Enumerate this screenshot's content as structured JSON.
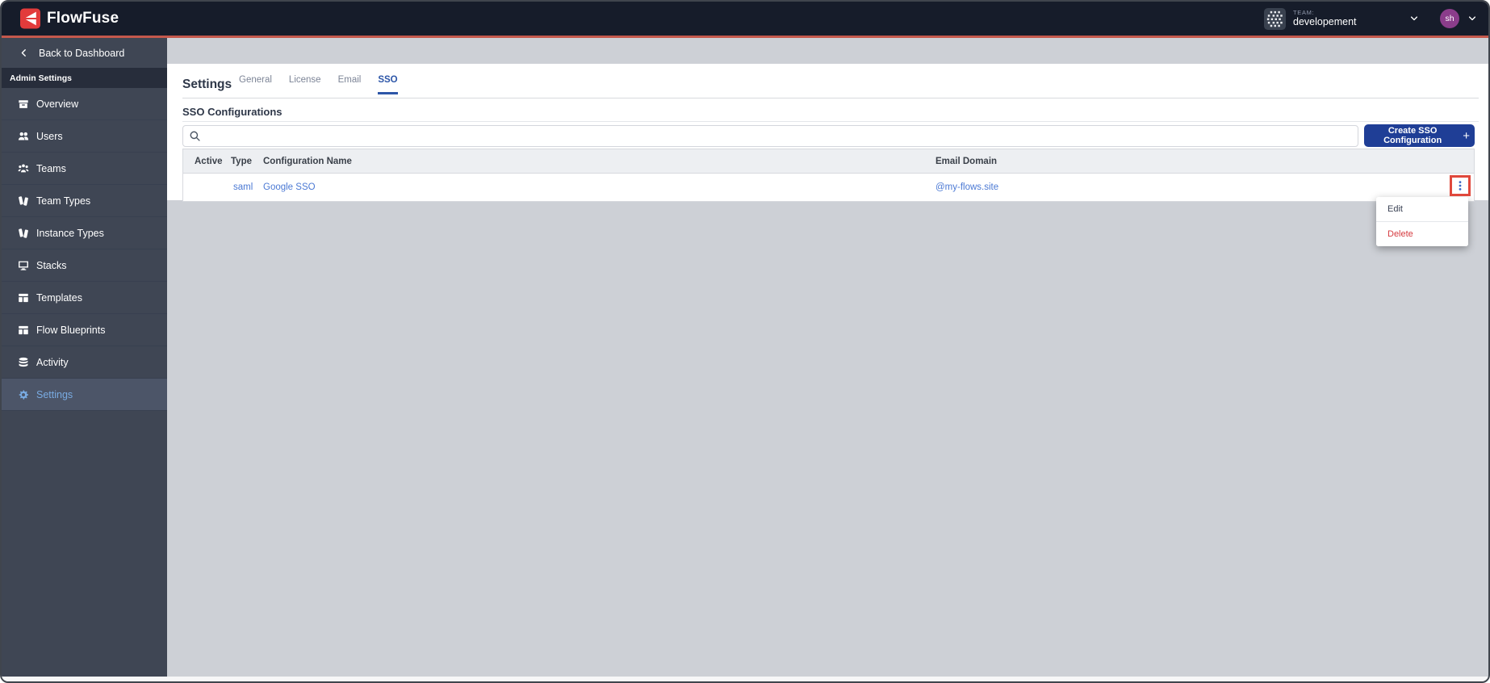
{
  "brand": {
    "name": "FlowFuse"
  },
  "topbar": {
    "team_label": "TEAM:",
    "team_name": "developement",
    "user_initials": "sh"
  },
  "sidebar": {
    "back_label": "Back to Dashboard",
    "section_label": "Admin Settings",
    "items": [
      {
        "label": "Overview",
        "icon": "overview",
        "active": false
      },
      {
        "label": "Users",
        "icon": "users",
        "active": false
      },
      {
        "label": "Teams",
        "icon": "teams",
        "active": false
      },
      {
        "label": "Team Types",
        "icon": "tag",
        "active": false
      },
      {
        "label": "Instance Types",
        "icon": "tag",
        "active": false
      },
      {
        "label": "Stacks",
        "icon": "monitor",
        "active": false
      },
      {
        "label": "Templates",
        "icon": "template",
        "active": false
      },
      {
        "label": "Flow Blueprints",
        "icon": "template",
        "active": false
      },
      {
        "label": "Activity",
        "icon": "database",
        "active": false
      },
      {
        "label": "Settings",
        "icon": "gear",
        "active": true
      }
    ]
  },
  "main": {
    "title": "Settings",
    "tabs": [
      {
        "label": "General",
        "active": false
      },
      {
        "label": "License",
        "active": false
      },
      {
        "label": "Email",
        "active": false
      },
      {
        "label": "SSO",
        "active": true
      }
    ],
    "section_title": "SSO Configurations",
    "create_button": {
      "label": "Create SSO Configuration",
      "plus": "+"
    },
    "table": {
      "columns": [
        "Active",
        "Type",
        "Configuration Name",
        "Email Domain"
      ],
      "rows": [
        {
          "active": "",
          "type": "saml",
          "name": "Google SSO",
          "email_domain": "@my-flows.site"
        }
      ]
    },
    "context_menu": {
      "items": [
        {
          "label": "Edit",
          "danger": false
        },
        {
          "label": "Delete",
          "danger": true
        }
      ]
    }
  },
  "colors": {
    "brand_red": "#e23b3b",
    "accent_line": "#c4584c",
    "primary_blue": "#1f3e96",
    "link_blue": "#4b79d4",
    "tab_blue": "#2d56a8",
    "danger_red": "#d53a3f",
    "highlight_red": "#e0483c",
    "active_item_blue": "#79abe2"
  }
}
